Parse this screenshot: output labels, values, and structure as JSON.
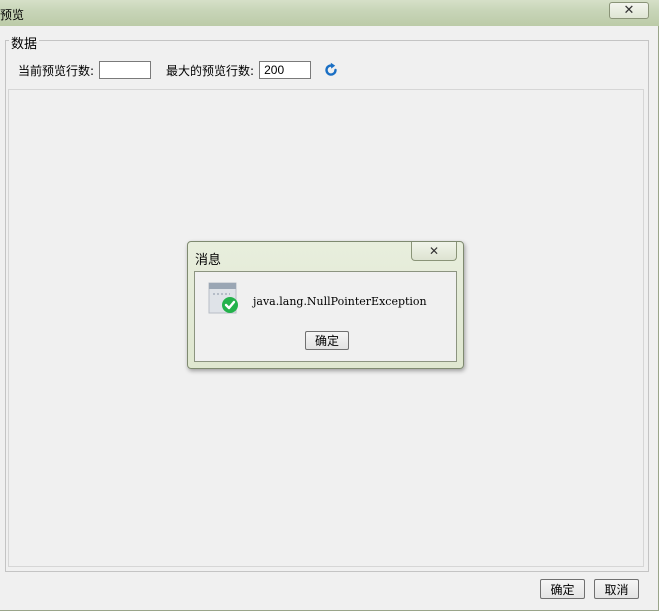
{
  "window": {
    "title": "预览",
    "close_icon": "close-icon",
    "close_glyph": "✕"
  },
  "group": {
    "legend": "数据",
    "current_rows_label": "当前预览行数:",
    "current_rows_value": "",
    "max_rows_label": "最大的预览行数:",
    "max_rows_value": "200",
    "refresh_icon": "refresh-icon"
  },
  "footer": {
    "ok_label": "确定",
    "cancel_label": "取消"
  },
  "dialog": {
    "title": "消息",
    "close_glyph": "✕",
    "message": "java.lang.NullPointerException",
    "ok_label": "确定",
    "icon": "info-check-icon"
  },
  "colors": {
    "titlebar": "#c8d5b8",
    "refresh_blue": "#1a6fc4",
    "check_green": "#23b24b"
  }
}
